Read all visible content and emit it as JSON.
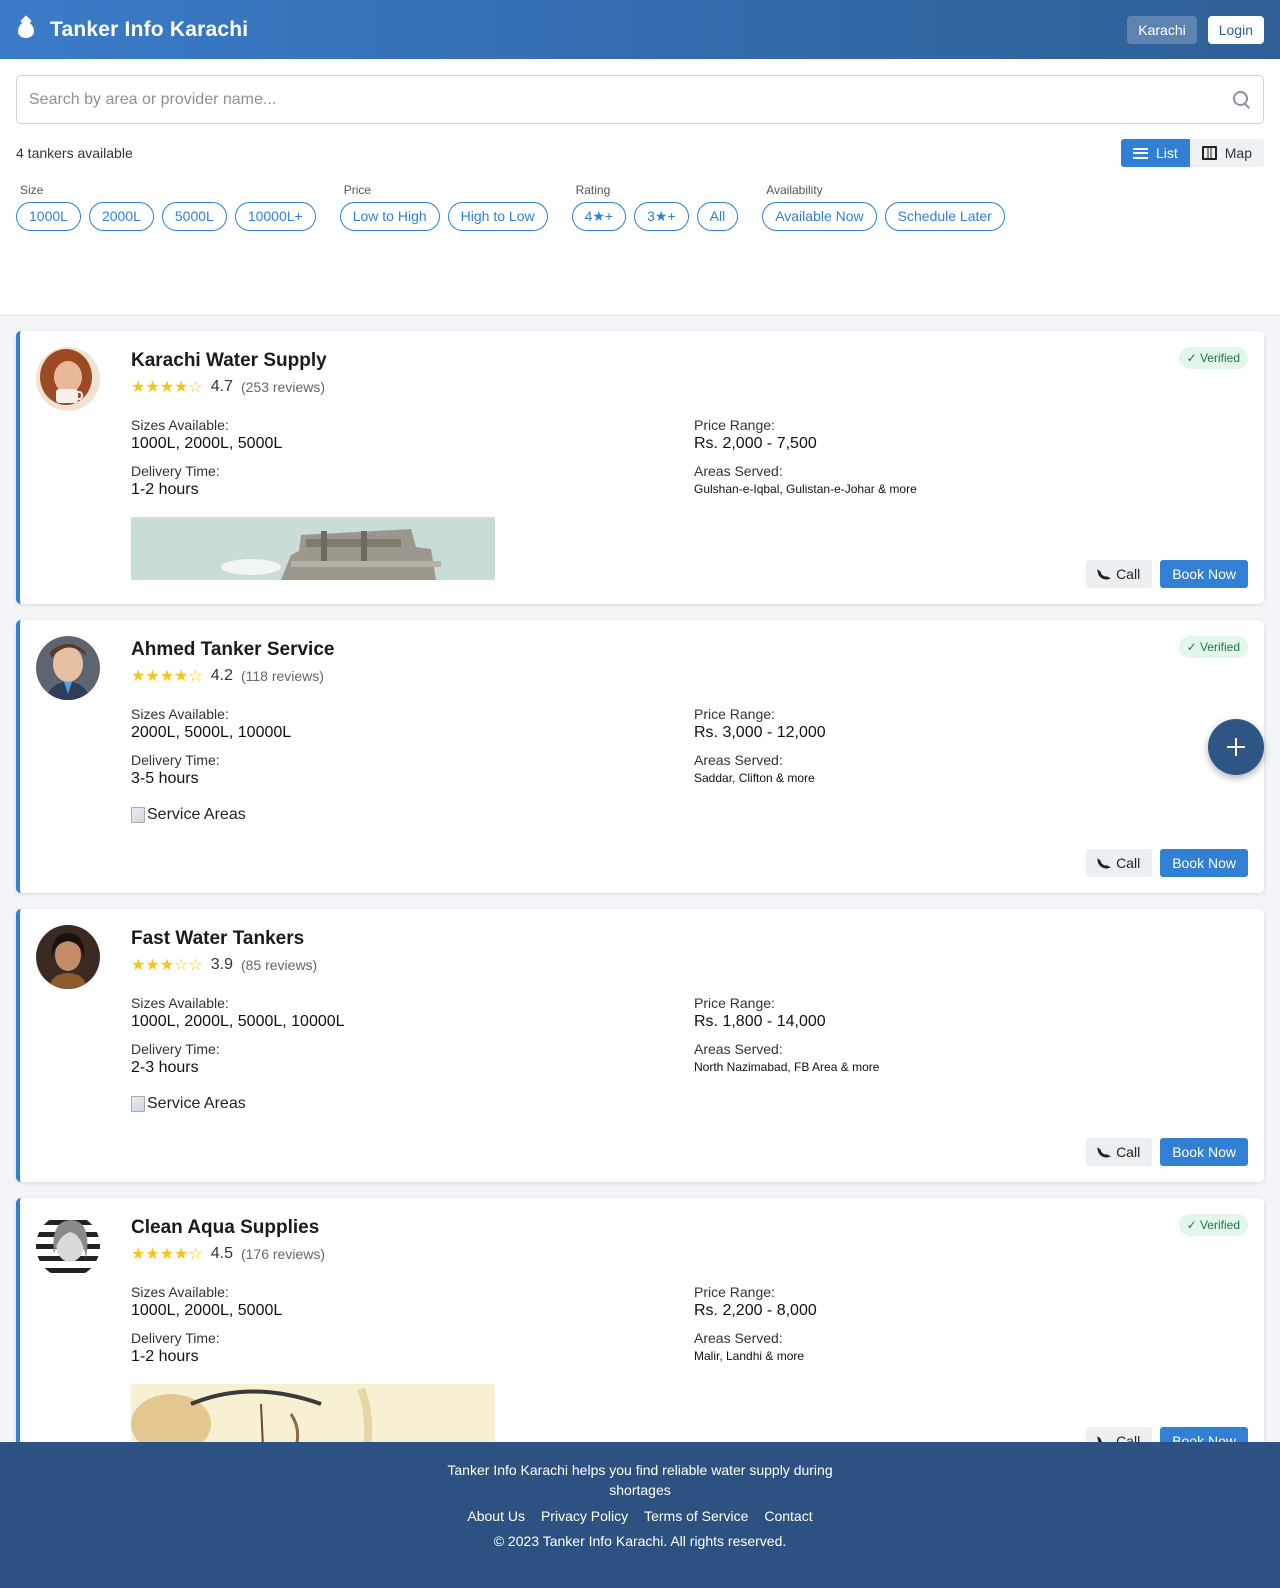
{
  "header": {
    "title": "Tanker Info Karachi",
    "city_label": "Karachi",
    "login_label": "Login"
  },
  "search": {
    "placeholder": "Search by area or provider name..."
  },
  "results": {
    "count_text": "4 tankers available",
    "view_list_label": "List",
    "view_map_label": "Map"
  },
  "filters": {
    "size": {
      "label": "Size",
      "options": [
        "1000L",
        "2000L",
        "5000L",
        "10000L+"
      ]
    },
    "price": {
      "label": "Price",
      "options": [
        "Low to High",
        "High to Low"
      ]
    },
    "rating": {
      "label": "Rating",
      "options": [
        "4★+",
        "3★+",
        "All"
      ]
    },
    "availability": {
      "label": "Availability",
      "options": [
        "Available Now",
        "Schedule Later"
      ]
    }
  },
  "card_labels": {
    "sizes": "Sizes Available:",
    "price": "Price Range:",
    "delivery": "Delivery Time:",
    "areas": "Areas Served:",
    "verified": "✓ Verified",
    "call": "Call",
    "book": "Book Now",
    "service_areas_alt": "Service Areas"
  },
  "providers": [
    {
      "name": "Karachi Water Supply",
      "stars": "★★★★☆",
      "rating": "4.7",
      "reviews": "(253 reviews)",
      "sizes": "1000L, 2000L, 5000L",
      "price": "Rs. 2,000 - 7,500",
      "delivery": "1-2 hours",
      "areas": "Gulshan-e-Iqbal, Gulistan-e-Johar & more",
      "verified": true
    },
    {
      "name": "Ahmed Tanker Service",
      "stars": "★★★★☆",
      "rating": "4.2",
      "reviews": "(118 reviews)",
      "sizes": "2000L, 5000L, 10000L",
      "price": "Rs. 3,000 - 12,000",
      "delivery": "3-5 hours",
      "areas": "Saddar, Clifton & more",
      "verified": true
    },
    {
      "name": "Fast Water Tankers",
      "stars": "★★★☆☆",
      "rating": "3.9",
      "reviews": "(85 reviews)",
      "sizes": "1000L, 2000L, 5000L, 10000L",
      "price": "Rs. 1,800 - 14,000",
      "delivery": "2-3 hours",
      "areas": "North Nazimabad, FB Area & more",
      "verified": false
    },
    {
      "name": "Clean Aqua Supplies",
      "stars": "★★★★☆",
      "rating": "4.5",
      "reviews": "(176 reviews)",
      "sizes": "1000L, 2000L, 5000L",
      "price": "Rs. 2,200 - 8,000",
      "delivery": "1-2 hours",
      "areas": "Malir, Landhi & more",
      "verified": true
    }
  ],
  "footer": {
    "tagline": "Tanker Info Karachi helps you find reliable water supply during shortages",
    "links": [
      "About Us",
      "Privacy Policy",
      "Terms of Service",
      "Contact"
    ],
    "copyright": "© 2023 Tanker Info Karachi. All rights reserved."
  },
  "colors": {
    "primary": "#3180d3",
    "header_dark": "#2f5f96",
    "footer": "#2d5281",
    "star": "#f5c518",
    "verified_bg": "#e3f6ea"
  }
}
